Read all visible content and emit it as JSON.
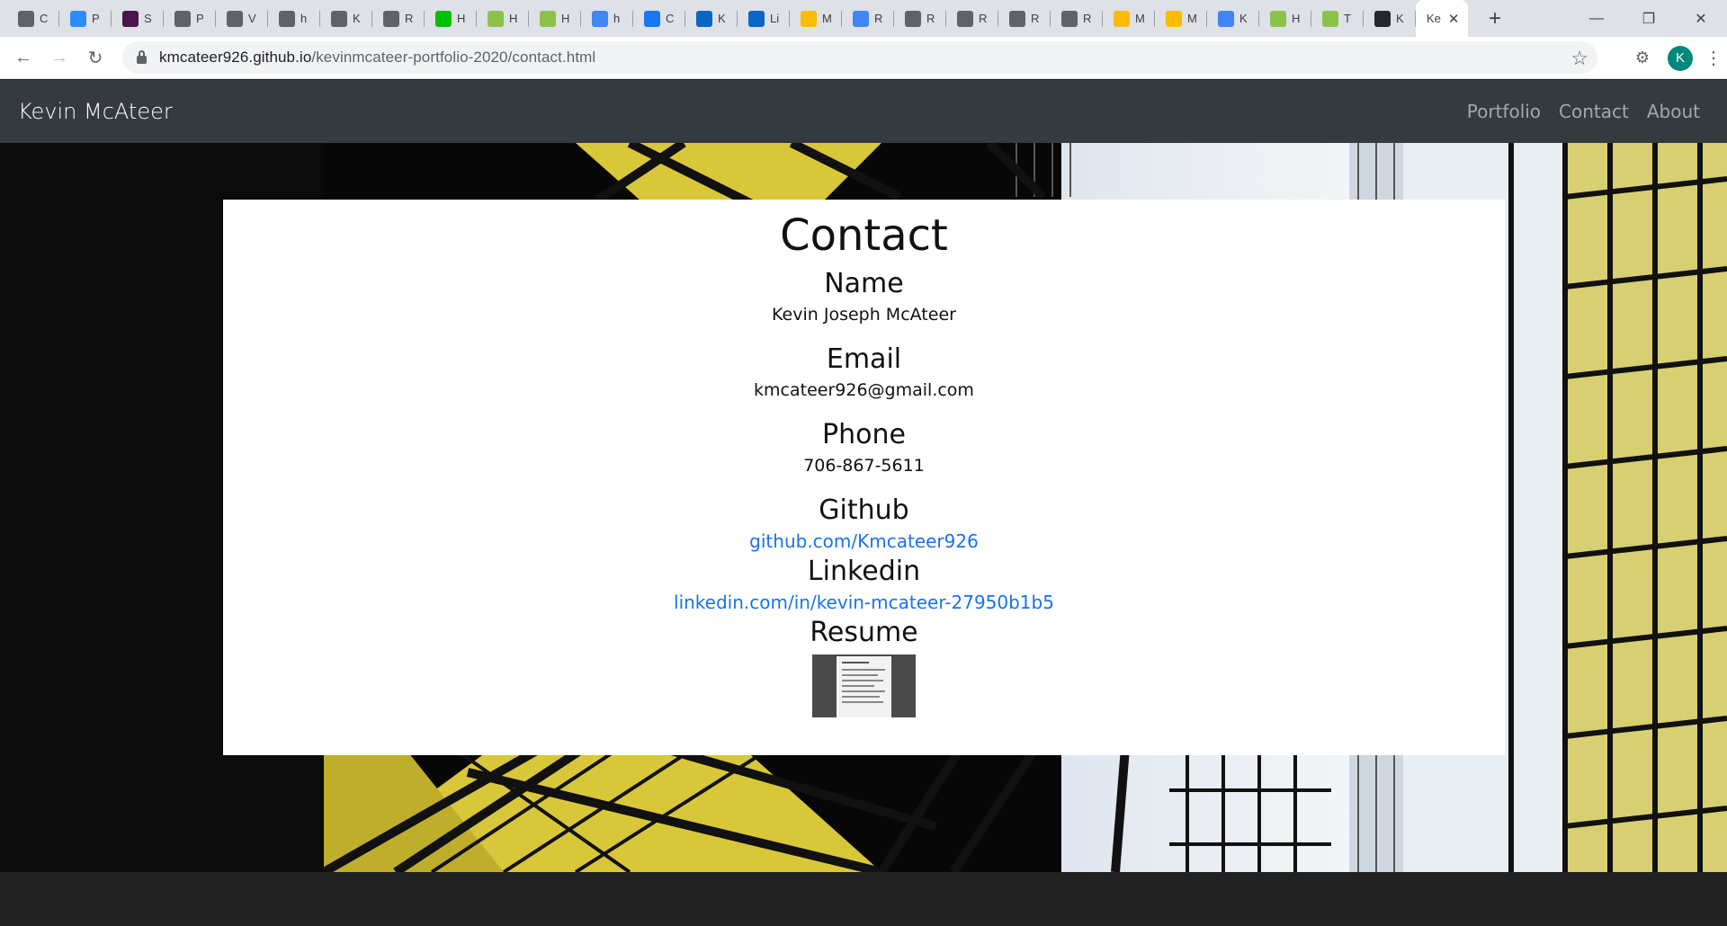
{
  "browser": {
    "tabs": [
      {
        "letter": "C",
        "color": "#5f6368"
      },
      {
        "letter": "P",
        "color": "#2d8cff"
      },
      {
        "letter": "S",
        "color": "#4a154b"
      },
      {
        "letter": "P",
        "color": "#5f6368"
      },
      {
        "letter": "V",
        "color": "#5f6368"
      },
      {
        "letter": "h",
        "color": "#5f6368"
      },
      {
        "letter": "K",
        "color": "#5f6368"
      },
      {
        "letter": "R",
        "color": "#5f6368"
      },
      {
        "letter": "H",
        "color": "#00c000"
      },
      {
        "letter": "H",
        "color": "#8bc34a"
      },
      {
        "letter": "H",
        "color": "#8bc34a"
      },
      {
        "letter": "h",
        "color": "#4285f4"
      },
      {
        "letter": "C",
        "color": "#1877f2"
      },
      {
        "letter": "K",
        "color": "#0a66c2"
      },
      {
        "letter": "Li",
        "color": "#0a66c2"
      },
      {
        "letter": "M",
        "color": "#fbbc04"
      },
      {
        "letter": "R",
        "color": "#4285f4"
      },
      {
        "letter": "R",
        "color": "#5f6368"
      },
      {
        "letter": "R",
        "color": "#5f6368"
      },
      {
        "letter": "R",
        "color": "#5f6368"
      },
      {
        "letter": "R",
        "color": "#5f6368"
      },
      {
        "letter": "M",
        "color": "#fbbc04"
      },
      {
        "letter": "M",
        "color": "#fbbc04"
      },
      {
        "letter": "K",
        "color": "#4285f4"
      },
      {
        "letter": "H",
        "color": "#8bc34a"
      },
      {
        "letter": "T",
        "color": "#8bc34a"
      },
      {
        "letter": "K",
        "color": "#24292e"
      }
    ],
    "active_tab": {
      "letter": "Ke",
      "close": "✕"
    },
    "new_tab": "+",
    "url_host": "kmcateer926.github.io",
    "url_path": "/kevinmcateer-portfolio-2020/contact.html",
    "profile_initial": "K"
  },
  "site": {
    "brand": "Kevin McAteer",
    "nav": [
      "Portfolio",
      "Contact",
      "About"
    ]
  },
  "contact": {
    "title": "Contact",
    "name_heading": "Name",
    "name_value": "Kevin Joseph McAteer",
    "email_heading": "Email",
    "email_value": "kmcateer926@gmail.com",
    "phone_heading": "Phone",
    "phone_value": "706-867-5611",
    "github_heading": "Github",
    "github_link": "github.com/Kmcateer926",
    "linkedin_heading": "Linkedin",
    "linkedin_link": "linkedin.com/in/kevin-mcateer-27950b1b5",
    "resume_heading": "Resume"
  },
  "colors": {
    "navbar": "#343a40",
    "link": "#1a73e8",
    "accent_yellow": "#e8d94a"
  }
}
